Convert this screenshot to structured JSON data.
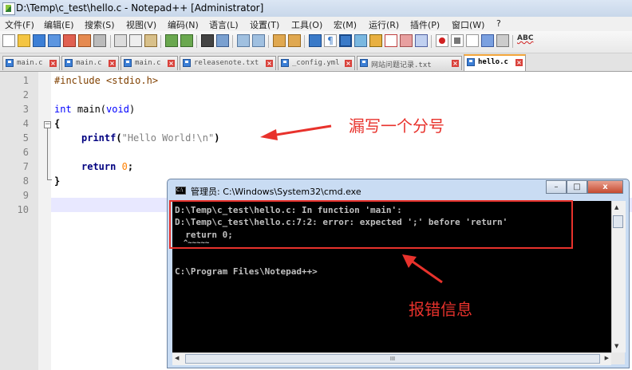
{
  "window": {
    "title": "D:\\Temp\\c_test\\hello.c - Notepad++ [Administrator]"
  },
  "menu": [
    "文件(F)",
    "编辑(E)",
    "搜索(S)",
    "视图(V)",
    "编码(N)",
    "语言(L)",
    "设置(T)",
    "工具(O)",
    "宏(M)",
    "运行(R)",
    "插件(P)",
    "窗口(W)",
    "?"
  ],
  "tabs": [
    {
      "label": "main.c"
    },
    {
      "label": "main.c"
    },
    {
      "label": "main.c"
    },
    {
      "label": "releasenote.txt"
    },
    {
      "label": "_config.yml"
    },
    {
      "label": "网站问题记录.txt"
    },
    {
      "label": "hello.c"
    }
  ],
  "editor": {
    "line_numbers": [
      "1",
      "2",
      "3",
      "4",
      "5",
      "6",
      "7",
      "8",
      "9",
      "10"
    ],
    "code": {
      "l1": "#include <stdio.h>",
      "l3_kw": "int",
      "l3_rest": " main(",
      "l3_void": "void",
      "l3_end": ")",
      "l4": "{",
      "l5_fn": "printf",
      "l5_open": "(",
      "l5_str": "\"Hello World!\\n\"",
      "l5_close": ")",
      "l7_kw": "return",
      "l7_num": "0",
      "l7_end": ";",
      "l8": "}"
    }
  },
  "annotations": {
    "missing_semicolon": "漏写一个分号",
    "error_info": "报错信息"
  },
  "cmd": {
    "title": "管理员: C:\\Windows\\System32\\cmd.exe",
    "lines": [
      "D:\\Temp\\c_test\\hello.c: In function 'main':",
      "D:\\Temp\\c_test\\hello.c:7:2: error: expected ';' before 'return'",
      "  return 0;",
      "  ^~~~~~",
      "",
      "C:\\Program Files\\Notepad++>"
    ],
    "hscroll_thumb": "III"
  },
  "colors": {
    "annotation": "#e8322c",
    "keyword": "#0000ff",
    "string": "#808080",
    "number": "#ff8000"
  }
}
